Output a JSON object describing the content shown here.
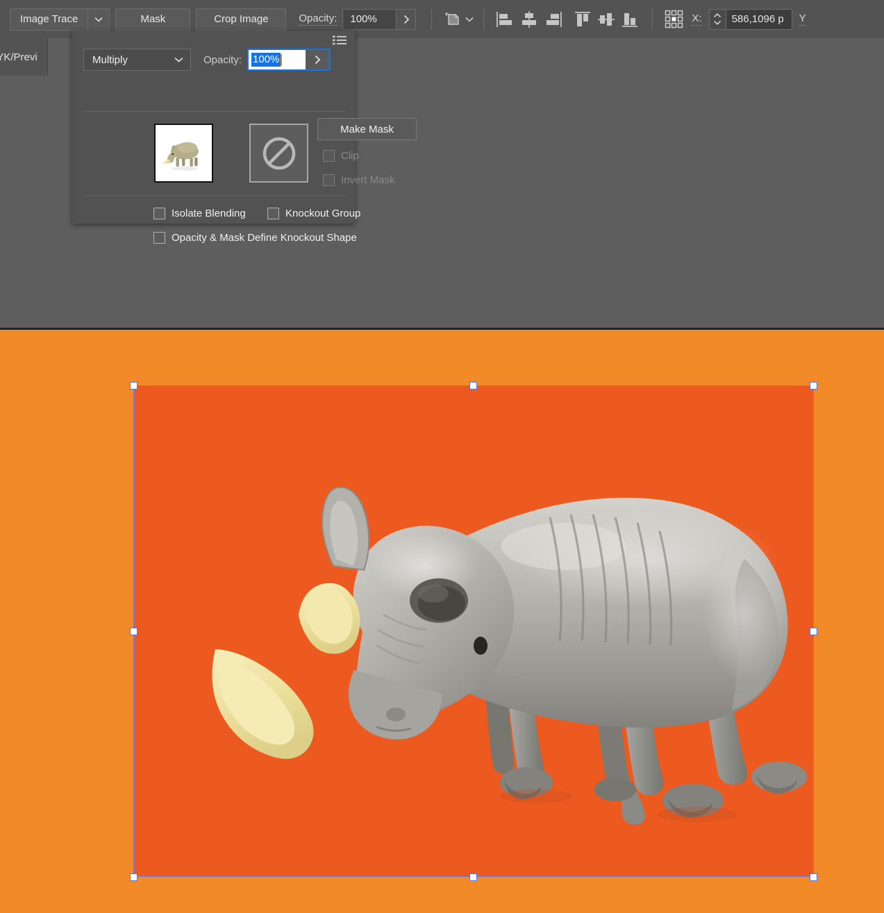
{
  "app": {
    "name": "Adobe Illustrator",
    "workspace_bg": "#5e5e5e",
    "toolbar_bg": "#535353",
    "panel_bg": "#525252"
  },
  "control_bar": {
    "image_trace_label": "Image Trace",
    "image_trace_dropdown_icon": "chevron-down-icon",
    "mask_label": "Mask",
    "crop_image_label": "Crop Image",
    "opacity_label": "Opacity:",
    "opacity_value": "100%",
    "opacity_expand_icon": "chevron-right-icon",
    "transform_icon": "artboard-transform-icon",
    "transform_dropdown_icon": "chevron-down-icon",
    "align_icons": [
      "align-left-icon",
      "align-center-horizontal-icon",
      "align-right-icon",
      "align-top-icon",
      "align-center-vertical-icon",
      "align-bottom-icon"
    ],
    "reference_point_icon": "reference-point-grid-icon",
    "x_label": "X:",
    "x_value": "586,1096 p",
    "x_stepper_icon": "stepper-up-down-icon",
    "y_label": "Y"
  },
  "document_tab": {
    "label": "CMYK/Previ"
  },
  "transparency_panel": {
    "menu_icon": "panel-menu-icon",
    "blend_mode": "Multiply",
    "blend_mode_icon": "chevron-down-icon",
    "opacity_label": "Opacity:",
    "opacity_value": "100%",
    "opacity_value_selected": true,
    "opacity_arrow_icon": "chevron-right-icon",
    "artwork_thumbnail_name": "rhino-artwork-thumbnail",
    "mask_thumbnail_icon": "no-mask-icon",
    "make_mask_label": "Make Mask",
    "clip_label": "Clip",
    "clip_checked": false,
    "clip_enabled": false,
    "invert_mask_label": "Invert Mask",
    "invert_mask_checked": false,
    "invert_mask_enabled": false,
    "isolate_blending_label": "Isolate Blending",
    "isolate_blending_checked": false,
    "knockout_group_label": "Knockout Group",
    "knockout_group_checked": false,
    "opacity_mask_knockout_label": "Opacity & Mask Define Knockout Shape",
    "opacity_mask_knockout_checked": false
  },
  "canvas": {
    "background_color": "#f28a28",
    "placed_image": {
      "name": "rhino-figurine-photo",
      "background_color": "#ec5a20",
      "subject": "gray rhinoceros figurine with pale yellow horns",
      "selected": true,
      "selection_color": "#6f7fe8",
      "handle_fill": "#ffffff",
      "handles": [
        "top-left",
        "top-center",
        "top-right",
        "middle-left",
        "middle-right",
        "bottom-left",
        "bottom-center",
        "bottom-right"
      ]
    }
  }
}
